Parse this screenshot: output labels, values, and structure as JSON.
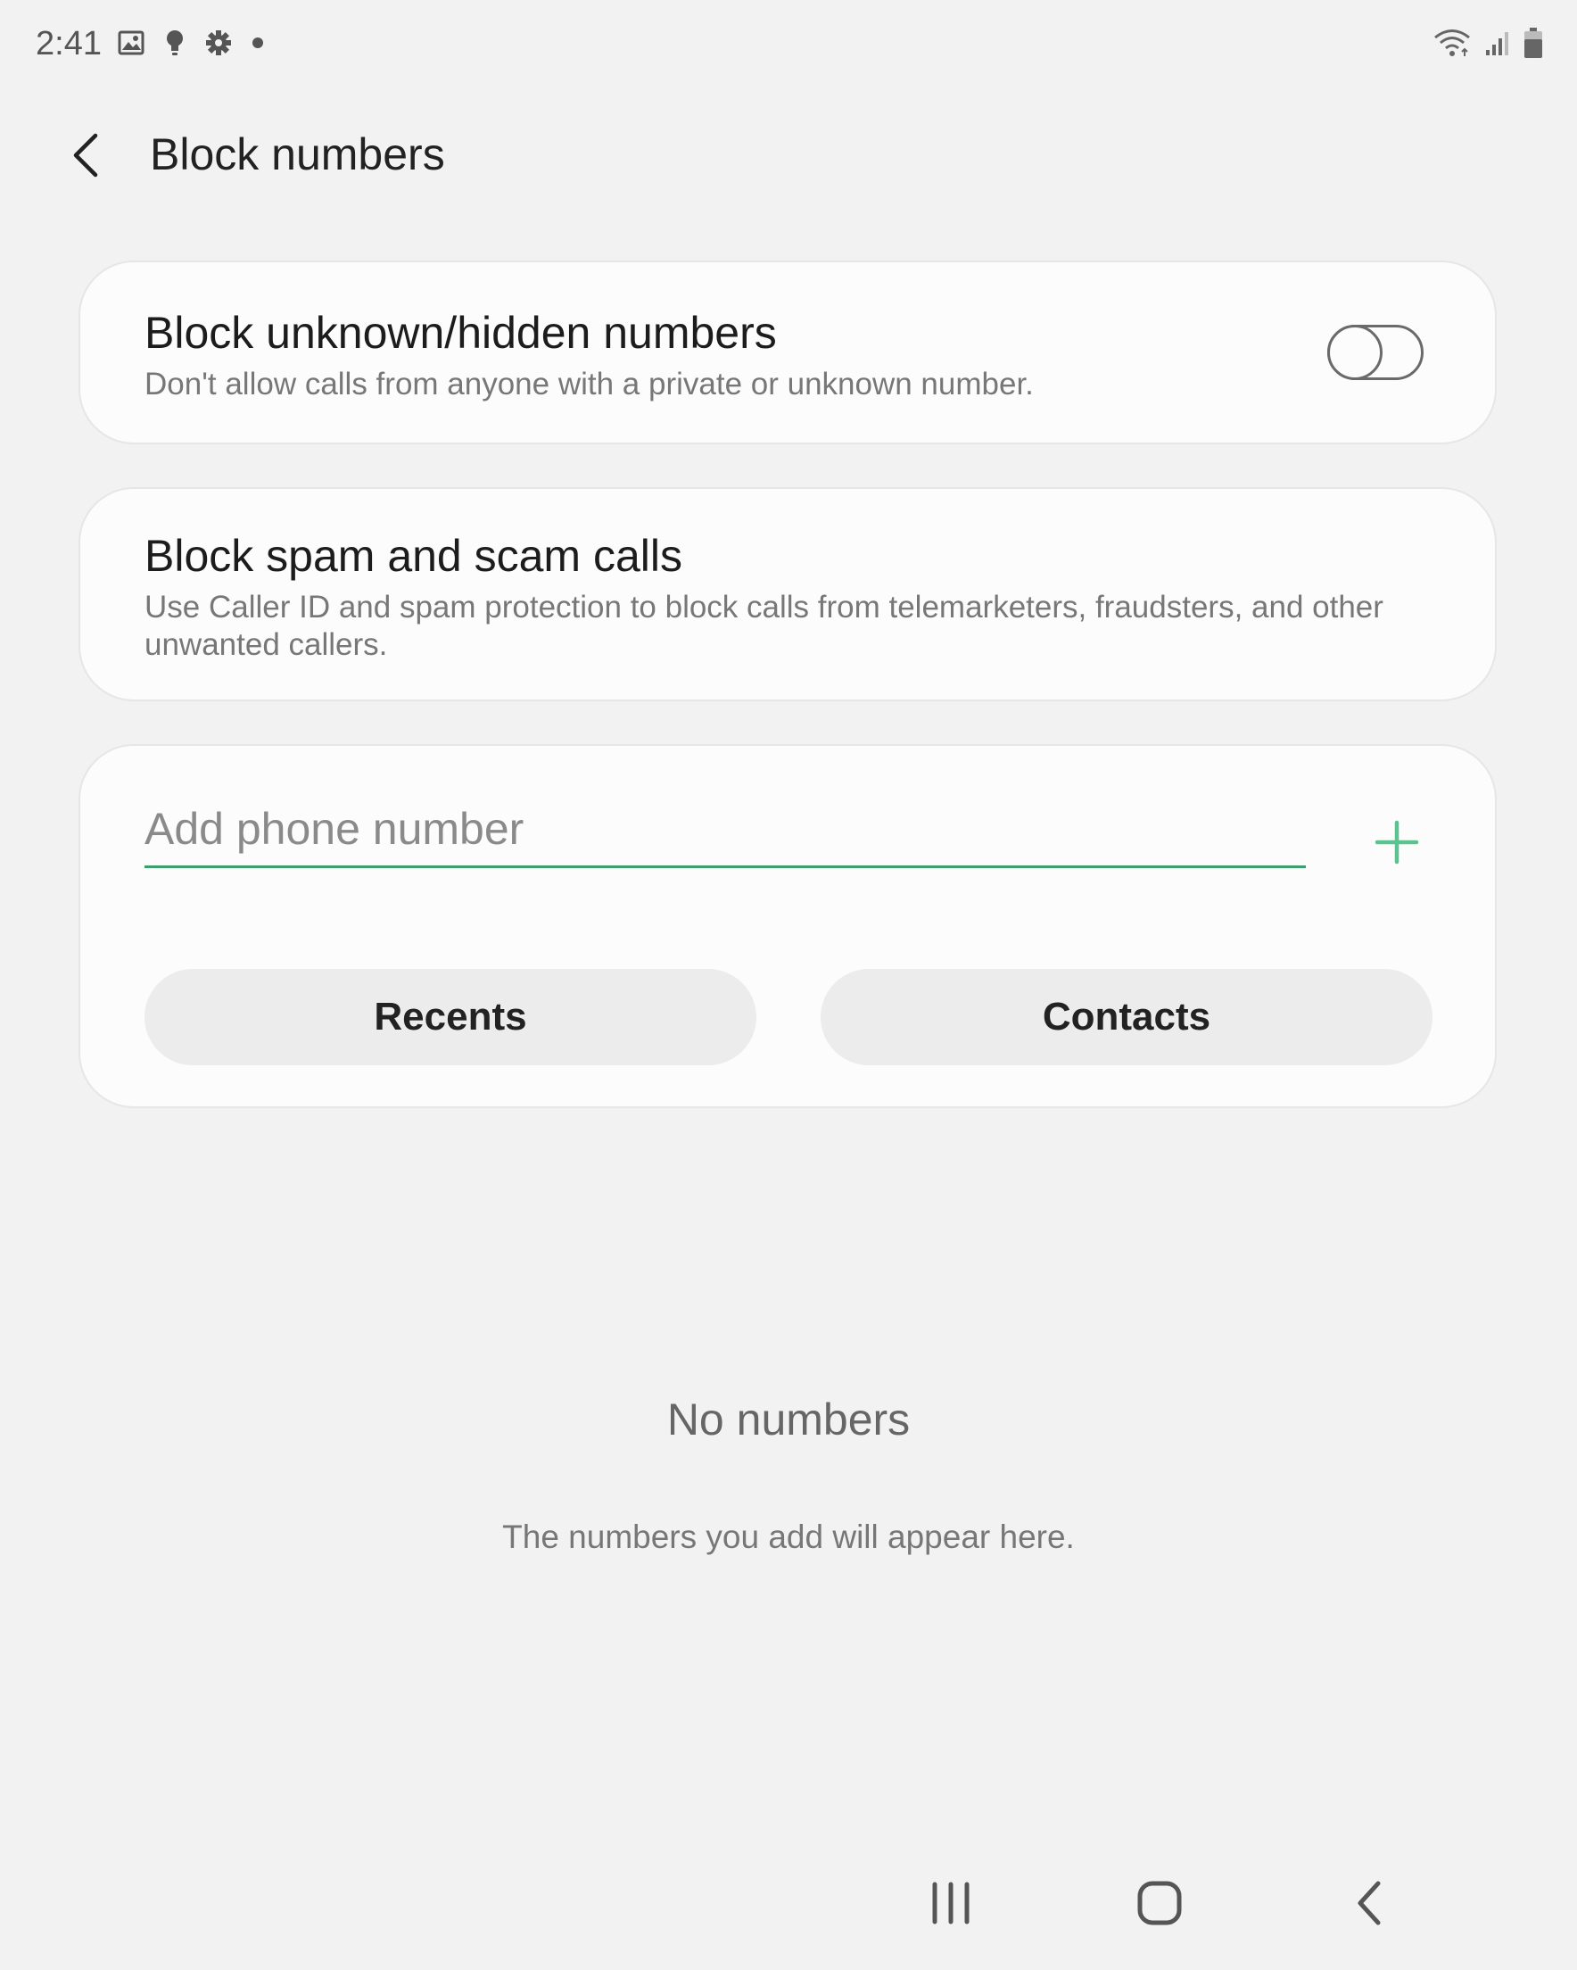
{
  "status_bar": {
    "time": "2:41",
    "left_icons": [
      "image-icon",
      "bulb-icon",
      "gear-icon",
      "dot-icon"
    ],
    "right_icons": [
      "wifi-icon",
      "signal-icon",
      "battery-icon"
    ]
  },
  "header": {
    "back_icon": "chevron-left-icon",
    "title": "Block numbers"
  },
  "block_unknown": {
    "title": "Block unknown/hidden numbers",
    "description": "Don't allow calls from anyone with a private or unknown number.",
    "enabled": false
  },
  "block_spam": {
    "title": "Block spam and scam calls",
    "description": "Use Caller ID and spam protection to block calls from telemarketers, fraudsters, and other unwanted callers."
  },
  "add_number": {
    "placeholder": "Add phone number",
    "value": "",
    "add_icon": "plus-icon",
    "recents_label": "Recents",
    "contacts_label": "Contacts"
  },
  "empty_state": {
    "title": "No numbers",
    "description": "The numbers you add will appear here."
  },
  "nav_bar": {
    "icons": [
      "recent-apps-icon",
      "home-icon",
      "back-icon"
    ]
  },
  "colors": {
    "background": "#f2f2f2",
    "card": "#fcfcfc",
    "accent": "#3a9f6b",
    "plus": "#5cc28f"
  }
}
